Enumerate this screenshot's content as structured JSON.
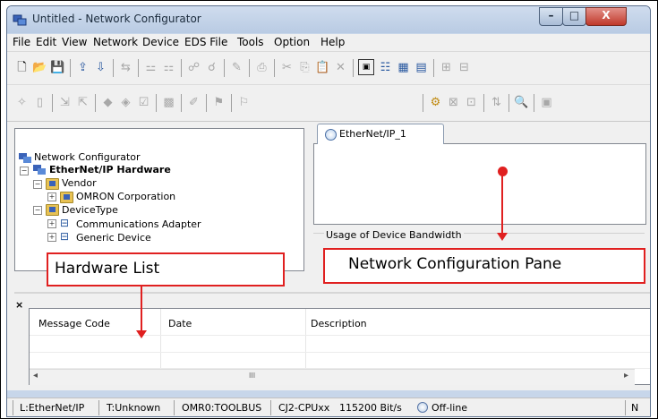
{
  "window": {
    "title": "Untitled - Network Configurator",
    "min_glyph": "–",
    "max_glyph": "□",
    "close_glyph": "X"
  },
  "menu": [
    {
      "label": "File"
    },
    {
      "label": "Edit"
    },
    {
      "label": "View"
    },
    {
      "label": "Network"
    },
    {
      "label": "Device"
    },
    {
      "label": "EDS File"
    },
    {
      "label": "Tools"
    },
    {
      "label": "Option"
    },
    {
      "label": "Help"
    }
  ],
  "tree": {
    "close_glyph": "×",
    "root": "Network Configurator",
    "hardware": "EtherNet/IP Hardware",
    "vendor": "Vendor",
    "omron": "OMRON Corporation",
    "devicetype": "DeviceType",
    "comm_adapter": "Communications Adapter",
    "generic_device": "Generic Device",
    "expand_minus": "−",
    "expand_plus": "+"
  },
  "network_tab": {
    "label": "EtherNet/IP_1"
  },
  "bandwidth": {
    "label": "Usage of Device Bandwidth"
  },
  "message_list": {
    "close_glyph": "×",
    "columns": [
      "Message Code",
      "Date",
      "Description"
    ],
    "scroll_left": "◂",
    "scroll_right": "▸",
    "scroll_thumb": "III"
  },
  "status": {
    "s1": "L:EtherNet/IP",
    "s2": "T:Unknown",
    "s3": "OMR0:TOOLBUS",
    "s4": "CJ2-CPUxx",
    "s5": "115200 Bit/s",
    "s6": "Off-line",
    "s7": "N"
  },
  "annotations": {
    "hardware_list": "Hardware List",
    "network_pane": "Network Configuration Pane"
  },
  "colors": {
    "callout_red": "#e02020",
    "title_bar": "#c7d6ea"
  }
}
